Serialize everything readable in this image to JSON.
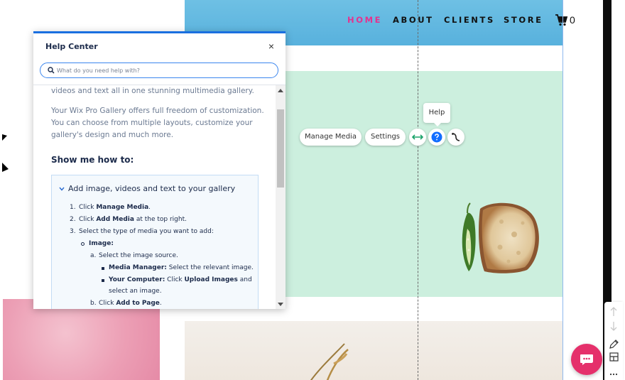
{
  "site": {
    "nav": [
      "HOME",
      "ABOUT",
      "CLIENTS",
      "STORE"
    ],
    "active_nav": "HOME",
    "cart_count": "0",
    "header_color": "#5db6df",
    "gallery_color": "#ccefde",
    "accent_pink": "#e3338f"
  },
  "gallery_toolbar": {
    "manage_media_label": "Manage Media",
    "settings_label": "Settings",
    "tooltip": "Help",
    "icons": [
      "stretch-icon",
      "help-icon",
      "animation-icon"
    ]
  },
  "help_center": {
    "title": "Help Center",
    "search_placeholder": "What do you need help with?",
    "intro_line": "videos and text all in one stunning multimedia gallery.",
    "paragraph_lines": [
      "Your Wix Pro Gallery offers full freedom of customization.",
      "You can choose from multiple layouts, customize your",
      "gallery's design and much more."
    ],
    "show_me_heading": "Show me how to:",
    "accordion": {
      "title": "Add image, videos and text to your gallery",
      "steps": [
        {
          "num": "1.",
          "pre": "Click ",
          "bold": "Manage Media",
          "post": "."
        },
        {
          "num": "2.",
          "pre": "Click ",
          "bold": "Add Media",
          "post": " at the top right."
        },
        {
          "num": "3.",
          "pre": "Select the type of media you want to add:",
          "bold": "",
          "post": ""
        }
      ],
      "media_type": "Image:",
      "substep_a": {
        "num": "a.",
        "text": "Select the image source."
      },
      "sources": [
        {
          "bold": "Media Manager:",
          "text": " Select the relevant image."
        },
        {
          "bold": "Your Computer:",
          "pre": " Click ",
          "bold2": "Upload Images",
          "text": " and",
          "text2": "select an image."
        }
      ],
      "substep_b": {
        "num": "b.",
        "pre": "Click ",
        "bold": "Add to Page",
        "post": "."
      }
    }
  },
  "editor": {
    "right_tools": [
      "arrow-up-icon",
      "arrow-down-icon",
      "pencil-icon",
      "layout-icon",
      "more-icon"
    ],
    "chat_color": "#e5306b"
  }
}
